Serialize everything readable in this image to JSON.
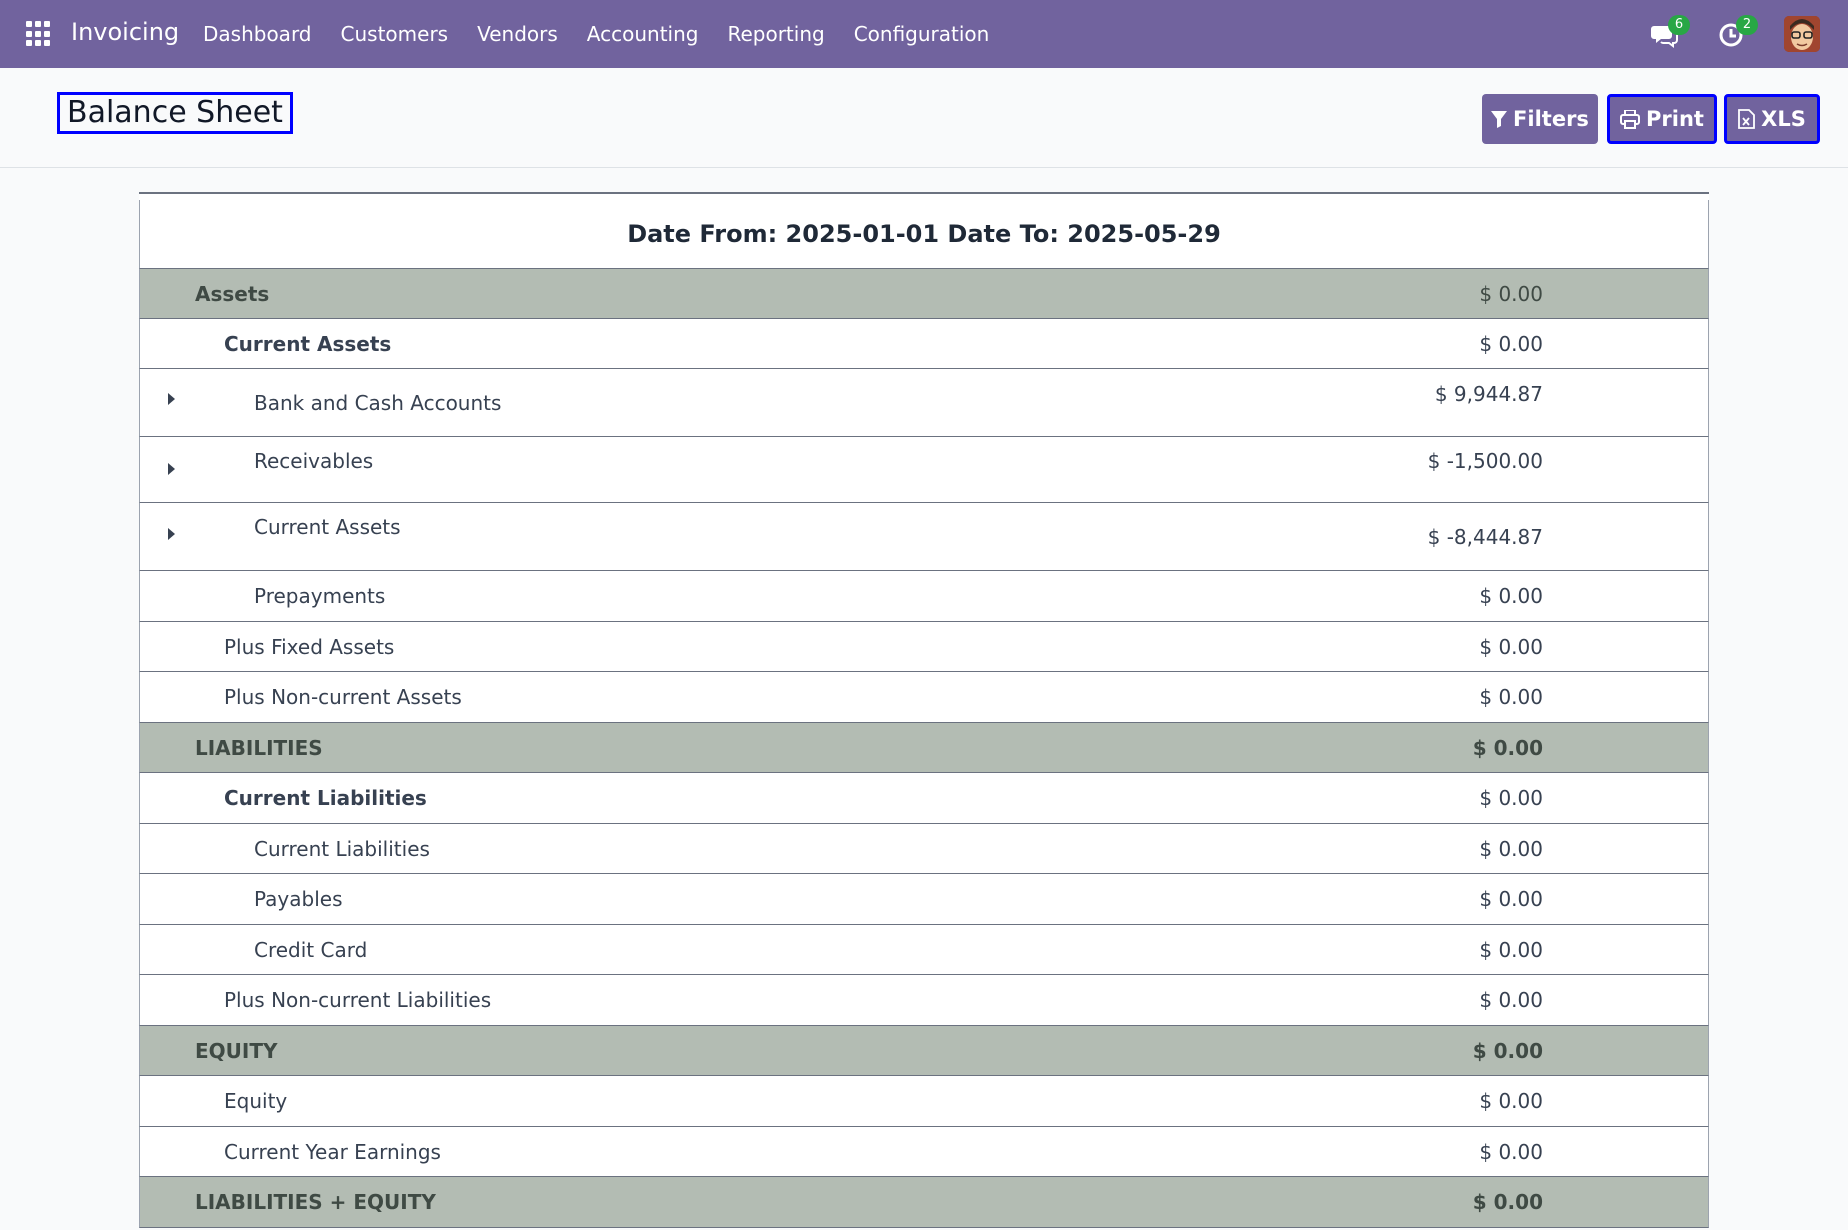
{
  "app": {
    "name": "Invoicing",
    "menu": [
      "Dashboard",
      "Customers",
      "Vendors",
      "Accounting",
      "Reporting",
      "Configuration"
    ],
    "messages_count": "6",
    "activities_count": "2"
  },
  "control_panel": {
    "title": "Balance Sheet",
    "filters_label": "Filters",
    "print_label": "Print",
    "xls_label": "XLS"
  },
  "report": {
    "header": "Date From: 2025-01-01 Date To: 2025-05-29",
    "rows": [
      {
        "label": "Assets",
        "amount": "$ 0.00",
        "kind": "section"
      },
      {
        "label": "Current Assets",
        "amount": "$ 0.00",
        "kind": "group"
      },
      {
        "label": "Bank and Cash Accounts",
        "amount": "$ 9,944.87",
        "kind": "account",
        "expandable": true
      },
      {
        "label": "Receivables",
        "amount": "$ -1,500.00",
        "kind": "account",
        "expandable": true
      },
      {
        "label": "Current Assets",
        "amount": "$ -8,444.87",
        "kind": "account",
        "expandable": true
      },
      {
        "label": "Prepayments",
        "amount": "$ 0.00",
        "kind": "account"
      },
      {
        "label": "Plus Fixed Assets",
        "amount": "$ 0.00",
        "kind": "subgroup"
      },
      {
        "label": "Plus Non-current Assets",
        "amount": "$ 0.00",
        "kind": "subgroup"
      },
      {
        "label": "LIABILITIES",
        "amount": "$ 0.00",
        "kind": "section"
      },
      {
        "label": "Current Liabilities",
        "amount": "$ 0.00",
        "kind": "group"
      },
      {
        "label": "Current Liabilities",
        "amount": "$ 0.00",
        "kind": "account"
      },
      {
        "label": "Payables",
        "amount": "$ 0.00",
        "kind": "account"
      },
      {
        "label": "Credit Card",
        "amount": "$ 0.00",
        "kind": "account"
      },
      {
        "label": "Plus Non-current Liabilities",
        "amount": "$ 0.00",
        "kind": "subgroup"
      },
      {
        "label": "EQUITY",
        "amount": "$ 0.00",
        "kind": "section"
      },
      {
        "label": "Equity",
        "amount": "$ 0.00",
        "kind": "subgroup"
      },
      {
        "label": "Current Year Earnings",
        "amount": "$ 0.00",
        "kind": "subgroup"
      },
      {
        "label": "LIABILITIES + EQUITY",
        "amount": "$ 0.00",
        "kind": "section"
      }
    ]
  },
  "colors": {
    "navbar": "#71639e",
    "section_row": "#b3bcb3",
    "badge": "#28a745",
    "highlight_border": "#0000ff"
  }
}
